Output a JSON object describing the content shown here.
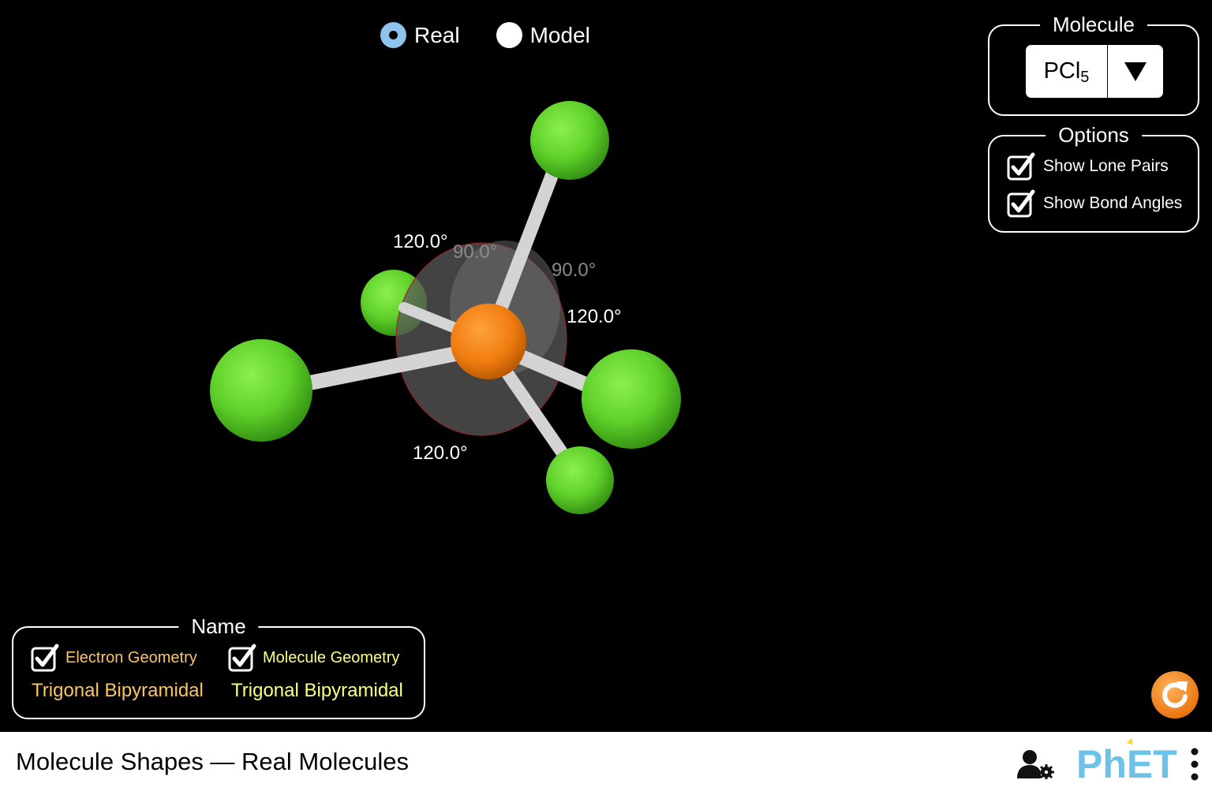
{
  "view_mode": {
    "options": [
      {
        "label": "Real",
        "selected": true
      },
      {
        "label": "Model",
        "selected": false
      }
    ]
  },
  "molecule_panel": {
    "title": "Molecule",
    "selected_formula": "PCl",
    "selected_subscript": "5",
    "arrow_icon": "triangle-down-icon"
  },
  "options_panel": {
    "title": "Options",
    "show_lone_pairs": {
      "label": "Show Lone Pairs",
      "checked": true
    },
    "show_bond_angles": {
      "label": "Show Bond Angles",
      "checked": true
    }
  },
  "bond_angles": [
    {
      "label": "120.0°",
      "layer": "front"
    },
    {
      "label": "90.0°",
      "layer": "back"
    },
    {
      "label": "90.0°",
      "layer": "back"
    },
    {
      "label": "120.0°",
      "layer": "front"
    },
    {
      "label": "120.0°",
      "layer": "front"
    }
  ],
  "name_panel": {
    "title": "Name",
    "electron_geometry": {
      "label": "Electron Geometry",
      "checked": true,
      "value": "Trigonal Bipyramidal",
      "color": "#f9c565"
    },
    "molecule_geometry": {
      "label": "Molecule Geometry",
      "checked": true,
      "value": "Trigonal Bipyramidal",
      "color": "#ffff80"
    }
  },
  "atoms": {
    "central": {
      "element": "P",
      "color": "#f07c10"
    },
    "ligand": {
      "element": "Cl",
      "color": "#5fd02a"
    },
    "ligand_count": 5
  },
  "colors": {
    "background": "#000000",
    "radio_selected": "#8ec4ee",
    "reset_button": "#f58a1f",
    "phet_blue": "#6dc2e7",
    "phet_yellow": "#f9d42a"
  },
  "navbar": {
    "title": "Molecule Shapes — Real Molecules",
    "preferences_icon": "user-gear-icon",
    "logo_text": "PhET",
    "menu_icon": "vertical-dots-icon"
  },
  "reset_icon": "reset-all-icon"
}
